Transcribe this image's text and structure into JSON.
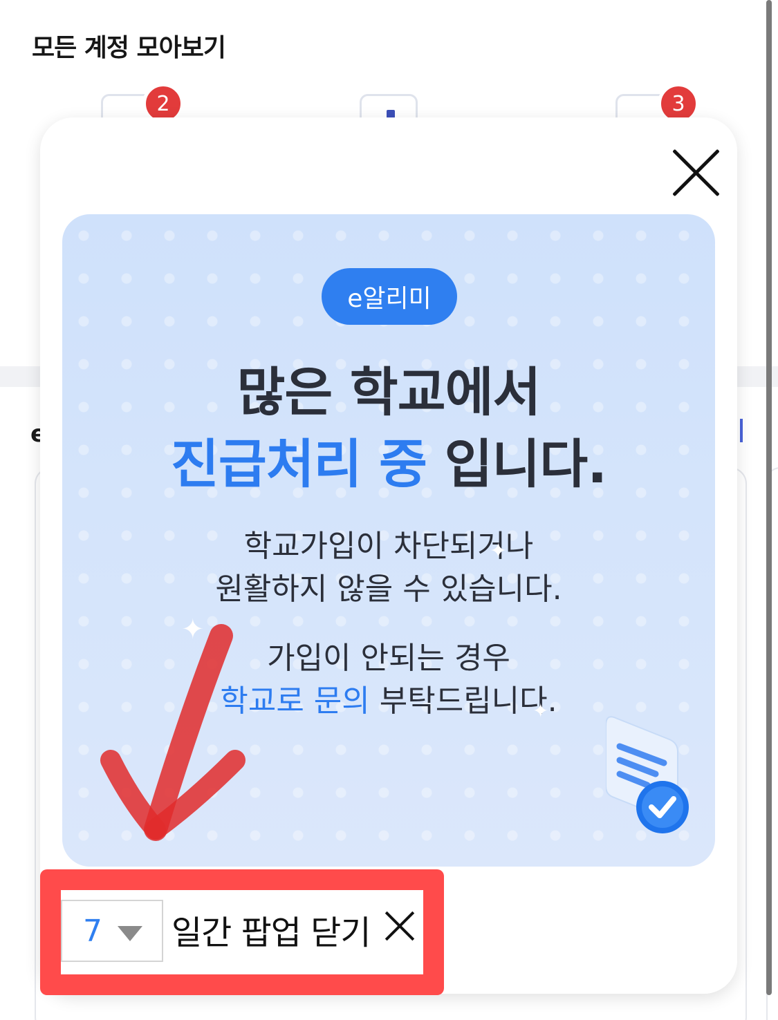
{
  "background": {
    "title": "모든 계정 모아보기",
    "accounts": [
      {
        "badge": "2"
      },
      {
        "badge": ""
      },
      {
        "badge": "3"
      }
    ],
    "section_letter": "e"
  },
  "popup": {
    "banner": {
      "tag": "e알리미",
      "headline_line1": "많은 학교에서",
      "headline_line2_accent": "진급처리 중",
      "headline_line2_rest": " 입니다.",
      "body_line1": "학교가입이 차단되거나",
      "body_line2": "원활하지 않을 수 있습니다.",
      "body_line3": "가입이 안되는 경우",
      "body_line4_accent": "학교로 문의",
      "body_line4_rest": " 부탁드립니다.",
      "accent_color": "#2d7cf0",
      "icon": "document-check-icon"
    },
    "close_icon": "close-icon",
    "footer": {
      "days_value": "7",
      "close_days_label": "일간 팝업 닫기",
      "close_days_icon": "close-icon"
    }
  },
  "annotation": {
    "box_color": "#ff4b4b",
    "arrow_color": "#e02b2b"
  }
}
